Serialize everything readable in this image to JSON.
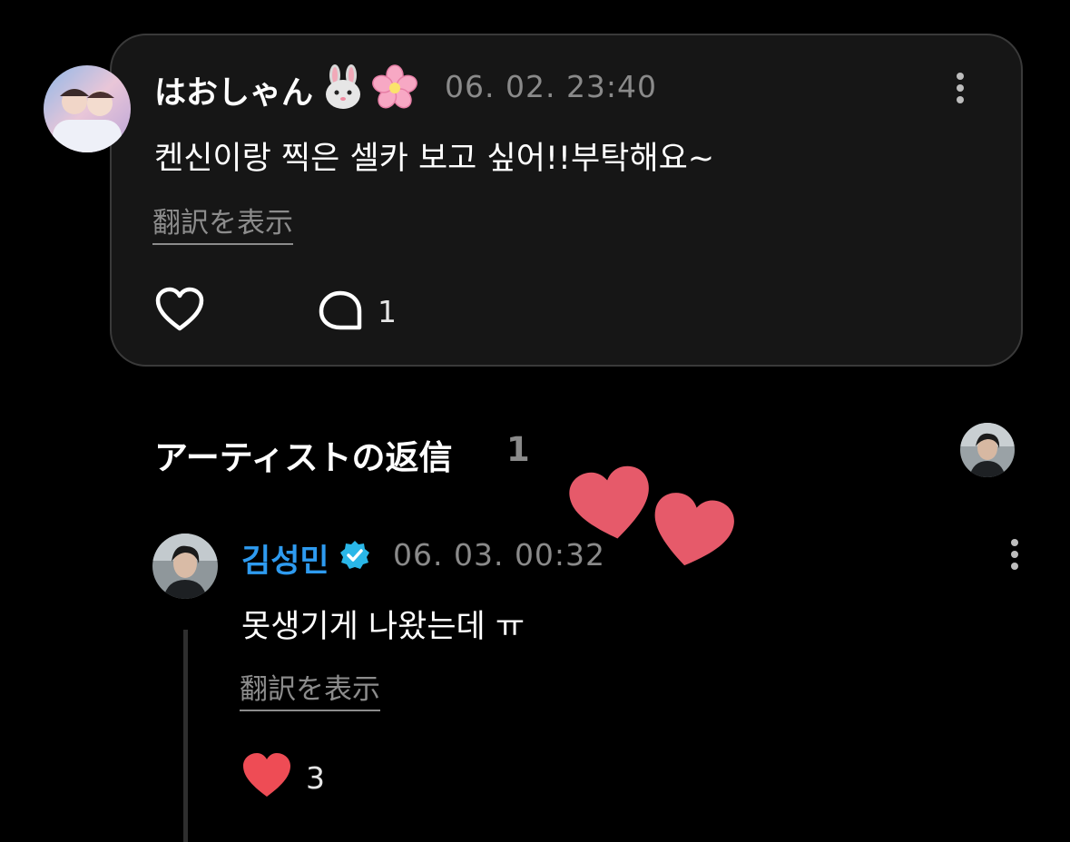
{
  "comment": {
    "username": "はおしゃん",
    "username_emojis": [
      "rabbit-face",
      "cherry-blossom"
    ],
    "timestamp": "06. 02. 23:40",
    "text": "켄신이랑 찍은 셀카 보고 싶어!!부탁해요~",
    "translate_label": "翻訳を表示",
    "reply_count": "1"
  },
  "replies_section": {
    "title": "アーティストの返信",
    "count": "1"
  },
  "artist_reply": {
    "name": "김성민",
    "verified_icon": "verified-badge-icon",
    "timestamp": "06. 03. 00:32",
    "text": "못생기게 나왔는데 ㅠ",
    "translate_label": "翻訳を表示",
    "like_count": "3"
  },
  "colors": {
    "background": "#000000",
    "card": "#161616",
    "artist_name": "#2e9bf0",
    "verified": "#2ab7e8",
    "liked_heart": "#ee4c55",
    "sticker_heart": "#e65a6a"
  }
}
